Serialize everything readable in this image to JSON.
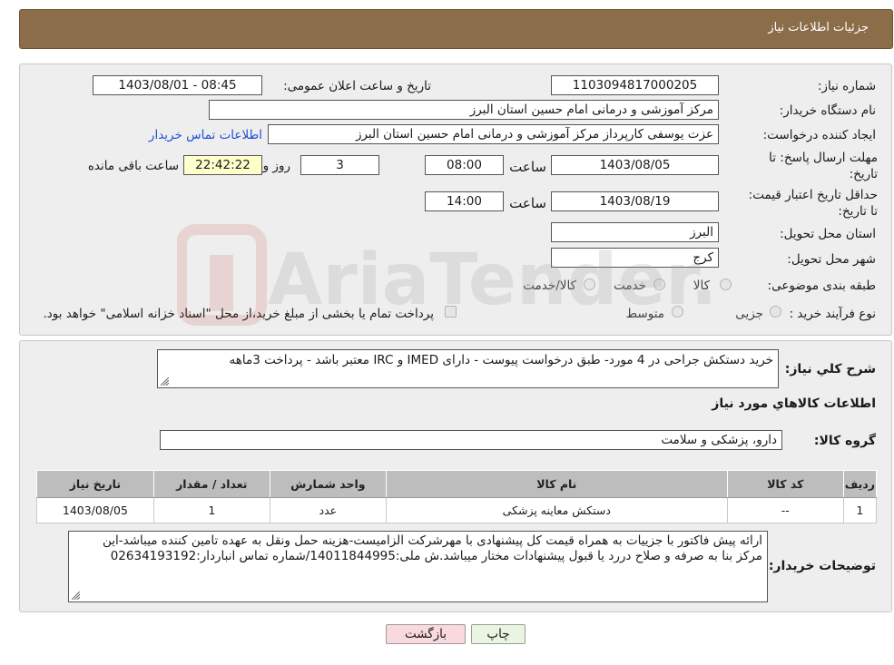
{
  "header": {
    "title": "جزئیات اطلاعات نیاز"
  },
  "form": {
    "need_number": {
      "label": "شماره نیاز:",
      "value": "1103094817000205"
    },
    "announce_datetime": {
      "label": "تاریخ و ساعت اعلان عمومی:",
      "value": "1403/08/01 - 08:45"
    },
    "buyer_org": {
      "label": "نام دستگاه خریدار:",
      "value": "مرکز آموزشی و درمانی امام حسین استان البرز"
    },
    "requester": {
      "label": "ایجاد کننده درخواست:",
      "value": "عزت یوسفی کارپرداز مرکز آموزشی و درمانی امام حسین استان البرز",
      "contact_link": "اطلاعات تماس خریدار"
    },
    "reply_deadline": {
      "label": "مهلت ارسال پاسخ: تا تاریخ:",
      "date": "1403/08/05",
      "time_label": "ساعت",
      "time": "08:00",
      "days": "3",
      "days_label": "روز و",
      "remaining": "22:42:22",
      "remaining_label": "ساعت باقی مانده"
    },
    "price_validity": {
      "label": "حداقل تاریخ اعتبار قیمت: تا تاریخ:",
      "date": "1403/08/19",
      "time_label": "ساعت",
      "time": "14:00"
    },
    "province": {
      "label": "استان محل تحویل:",
      "value": "البرز"
    },
    "city": {
      "label": "شهر محل تحویل:",
      "value": "کرج"
    },
    "category": {
      "label": "طبقه بندی موضوعی:",
      "options": [
        "کالا",
        "خدمت",
        "کالا/خدمت"
      ]
    },
    "process_type": {
      "label": "نوع فرآیند خرید :",
      "options": [
        "جزیی",
        "متوسط"
      ],
      "note": "پرداخت تمام یا بخشی از مبلغ خرید،از محل \"اسناد خزانه اسلامی\" خواهد بود."
    }
  },
  "description": {
    "label": "شرح کلي نياز:",
    "value": "خرید دستکش جراحی در 4 مورد- طبق درخواست پیوست - دارای IMED  و IRC  معتبر باشد - پرداخت 3ماهه"
  },
  "goods_section": {
    "title": "اطلاعات کالاهاي مورد نياز",
    "group_label": "گروه کالا:",
    "group_value": "دارو، پزشکی و سلامت"
  },
  "items_table": {
    "headers": [
      "رديف",
      "کد کالا",
      "نام کالا",
      "واحد شمارش",
      "تعداد / مقدار",
      "تاریخ نیاز"
    ],
    "rows": [
      [
        "1",
        "--",
        "دستکش معاینه پزشکی",
        "عدد",
        "1",
        "1403/08/05"
      ]
    ]
  },
  "buyer_notes": {
    "label": "توضیحات خریدار:",
    "value": "ارائه پیش فاکتور با جزییات به همراه قیمت کل پیشنهادی با مهرشرکت الزامیست-هزینه حمل ونقل به عهده تامین کننده میباشد-این مرکز بنا به صرفه و صلاح دررد یا قبول پیشنهادات مختار میباشد.ش ملی:14011844995/شماره تماس انباردار:02634193192"
  },
  "buttons": {
    "print": "چاپ",
    "back": "بازگشت"
  },
  "watermark": {
    "text": "AriaTender.neT"
  },
  "colors": {
    "header": "#8c6d4a",
    "link": "#1f4fd8",
    "back_button": "#f9d9dd",
    "print_button": "#e9f5e0"
  }
}
